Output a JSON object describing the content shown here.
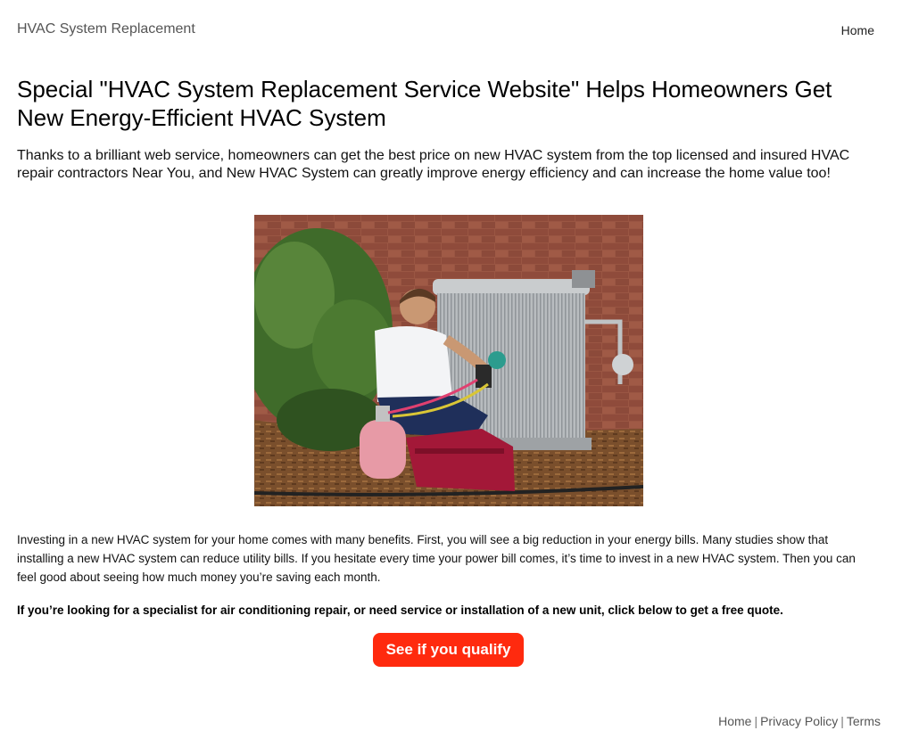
{
  "header": {
    "brand": "HVAC System Replacement",
    "nav_home": "Home"
  },
  "article": {
    "headline": "Special \"HVAC System Replacement Service Website\" Helps Homeowners Get New Energy-Efficient HVAC System",
    "lead": "Thanks to a brilliant web service, homeowners can get the best price on new HVAC system from the top licensed and insured HVAC repair contractors Near You, and New HVAC System can greatly improve energy efficiency and can increase the home value too!",
    "hero_image": "technician-servicing-ac-unit-photo",
    "body": "Investing in a new HVAC system for your home comes with many benefits. First, you will see a big reduction in your energy bills. Many studies show that installing a new HVAC system can reduce utility bills. If you hesitate every time your power bill comes, it’s time to invest in a new HVAC system. Then you can feel good about seeing how much money you’re saving each month.",
    "cta_text": "If you’re looking for a specialist for air conditioning repair, or need service or installation of a new unit, click below to get a free quote.",
    "cta_button": "See if you qualify"
  },
  "footer": {
    "home": "Home",
    "privacy": "Privacy Policy",
    "terms": "Terms",
    "separator": "|"
  },
  "colors": {
    "cta": "#ff2a0e",
    "brand_text": "#555555"
  }
}
